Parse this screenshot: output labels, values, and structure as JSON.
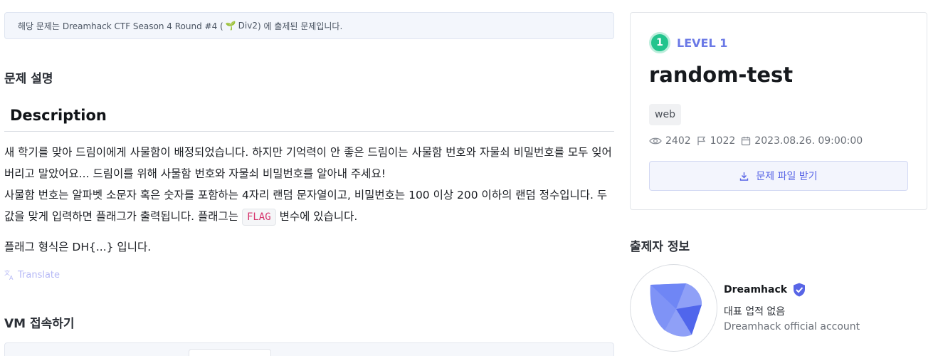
{
  "notice": {
    "prefix": "해당 문제는 Dreamhack CTF Season 4 Round #4 (",
    "sprout": "🌱",
    "division": "Div2",
    "suffix": ") 에 출제된 문제입니다."
  },
  "problem": {
    "section_title": "문제 설명",
    "heading": "Description",
    "para1": "새 학기를 맞아 드림이에게 사물함이 배정되었습니다. 하지만 기억력이 안 좋은 드림이는 사물함 번호와 자물쇠 비밀번호를 모두 잊어버리고 말았어요... 드림이를 위해 사물함 번호와 자물쇠 비밀번호를 알아내 주세요!",
    "para2_before": "사물함 번호는 알파벳 소문자 혹은 숫자를 포함하는 4자리 랜덤 문자열이고, 비밀번호는 100 이상 200 이하의 랜덤 정수입니다. 두 값을 맞게 입력하면 플래그가 출력됩니다. 플래그는 ",
    "para2_code": "FLAG",
    "para2_after": " 변수에 있습니다.",
    "flag_format": "플래그 형식은 DH{...} 입니다.",
    "translate_label": "Translate"
  },
  "vm": {
    "section_title": "VM 접속하기"
  },
  "challenge": {
    "level_number": "1",
    "level_label": "LEVEL 1",
    "title": "random-test",
    "tag": "web",
    "views": "2402",
    "solves": "1022",
    "date": "2023.08.26. 09:00:00",
    "download_label": "문제 파일 받기"
  },
  "author": {
    "section_title": "출제자 정보",
    "name": "Dreamhack",
    "achievement": "대표 업적 없음",
    "description": "Dreamhack official account"
  },
  "colors": {
    "accent": "#5865e6",
    "level_green": "#23c48d",
    "code_red": "#d6336c"
  }
}
